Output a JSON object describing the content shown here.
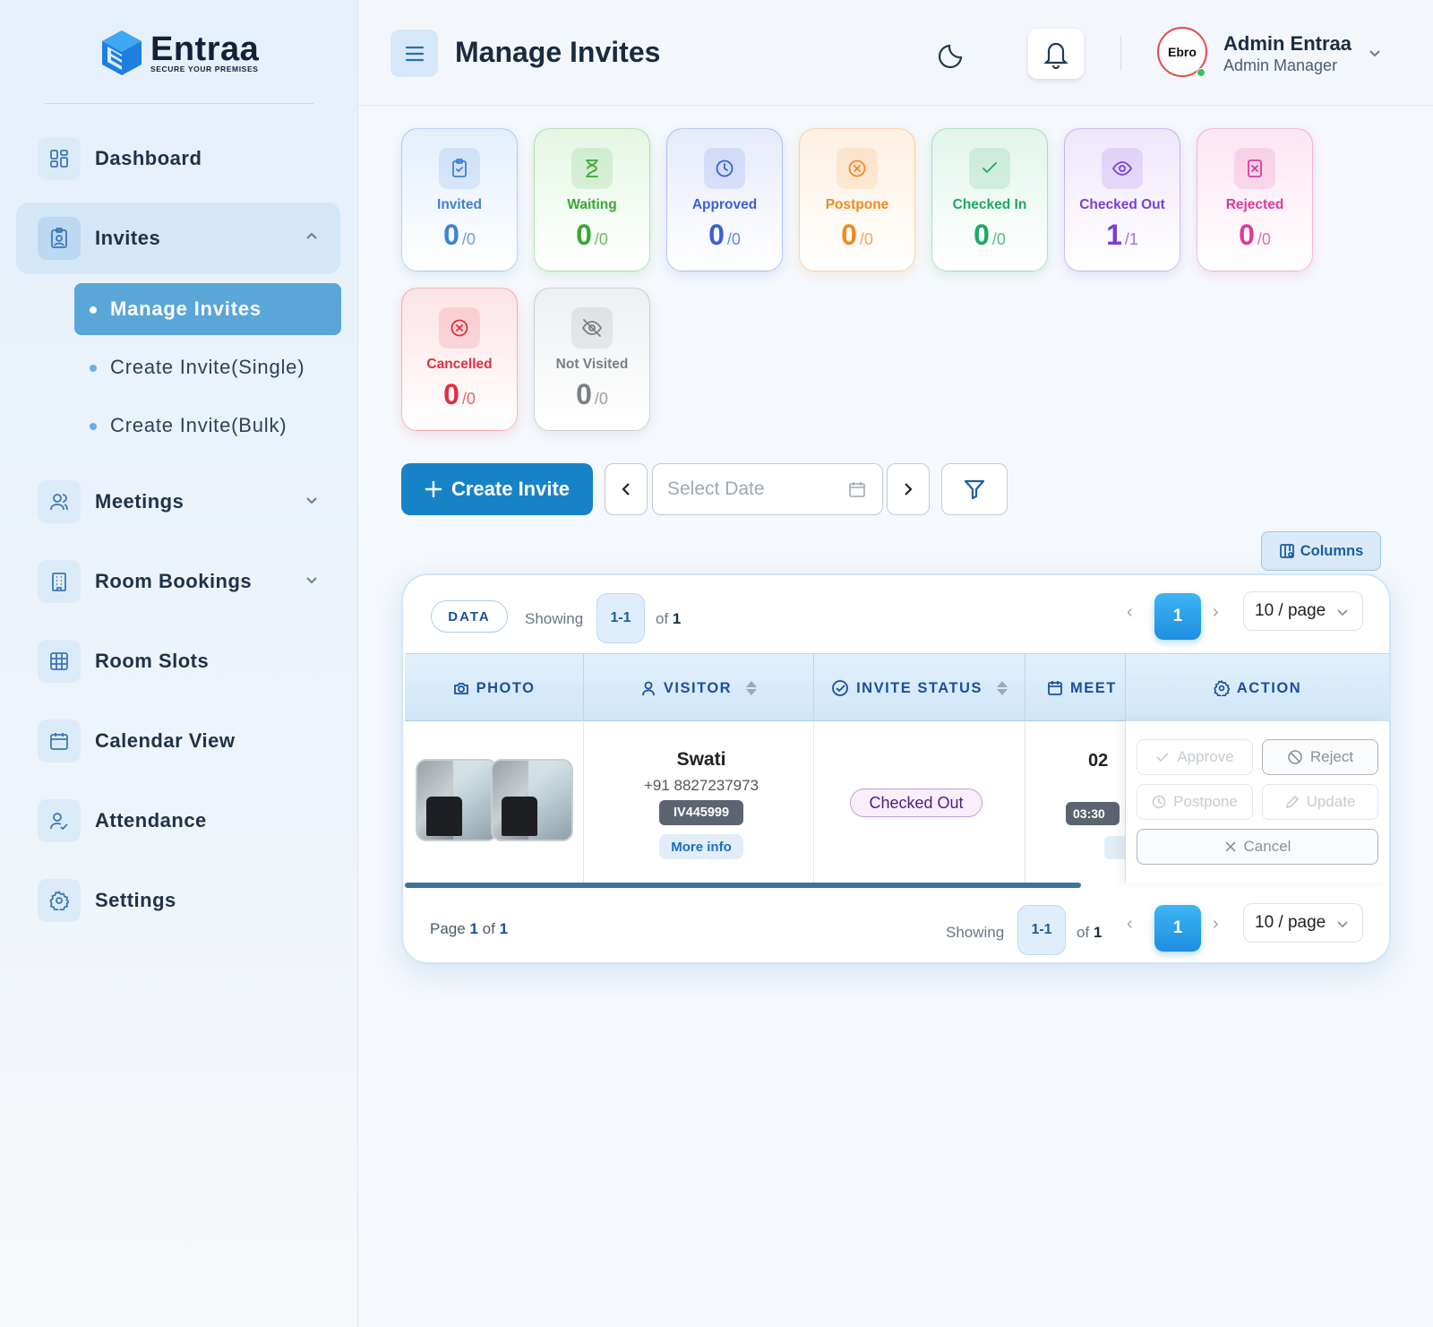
{
  "brand": {
    "name": "Entraa",
    "tagline": "SECURE YOUR PREMISES"
  },
  "sidebar": {
    "items": [
      {
        "label": "Dashboard",
        "icon": "dashboard-icon"
      },
      {
        "label": "Invites",
        "icon": "badge-icon",
        "expanded": true
      },
      {
        "label": "Meetings",
        "icon": "users-icon"
      },
      {
        "label": "Room Bookings",
        "icon": "building-icon"
      },
      {
        "label": "Room Slots",
        "icon": "grid-icon"
      },
      {
        "label": "Calendar View",
        "icon": "calendar-icon"
      },
      {
        "label": "Attendance",
        "icon": "user-check-icon"
      },
      {
        "label": "Settings",
        "icon": "gear-icon"
      }
    ],
    "invites_sub": [
      {
        "label": "Manage Invites",
        "active": true
      },
      {
        "label": "Create Invite(Single)"
      },
      {
        "label": "Create Invite(Bulk)"
      }
    ]
  },
  "header": {
    "title": "Manage Invites",
    "user": {
      "name": "Admin Entraa",
      "role": "Admin Manager",
      "avatar_text": "Ebro"
    }
  },
  "stats": [
    {
      "label": "Invited",
      "value": "0",
      "total": "/0",
      "color": "#3b82d6",
      "icon": "clipboard-check-icon"
    },
    {
      "label": "Waiting",
      "value": "0",
      "total": "/0",
      "color": "#3aa636",
      "icon": "hourglass-icon"
    },
    {
      "label": "Approved",
      "value": "0",
      "total": "/0",
      "color": "#3b5fd6",
      "icon": "clock-icon"
    },
    {
      "label": "Postpone",
      "value": "0",
      "total": "/0",
      "color": "#f08a1e",
      "icon": "circle-x-icon"
    },
    {
      "label": "Checked In",
      "value": "0",
      "total": "/0",
      "color": "#1ea862",
      "icon": "check-icon"
    },
    {
      "label": "Checked Out",
      "value": "1",
      "total": "/1",
      "color": "#7b3fd6",
      "icon": "eye-icon"
    },
    {
      "label": "Rejected",
      "value": "0",
      "total": "/0",
      "color": "#e0389a",
      "icon": "square-x-icon"
    },
    {
      "label": "Cancelled",
      "value": "0",
      "total": "/0",
      "color": "#e0303f",
      "icon": "circle-x-icon"
    },
    {
      "label": "Not Visited",
      "value": "0",
      "total": "/0",
      "color": "#7a7f86",
      "icon": "eye-off-icon"
    }
  ],
  "toolbar": {
    "create_label": "Create Invite",
    "date_placeholder": "Select Date",
    "columns_label": "Columns"
  },
  "table": {
    "data_label": "DATA",
    "showing_label": "Showing",
    "range": "1-1",
    "of_label": "of",
    "total": "1",
    "current_page": "1",
    "page_size": "10 / page",
    "columns": [
      "PHOTO",
      "VISITOR",
      "INVITE STATUS",
      "MEET",
      "ACTION"
    ],
    "rows": [
      {
        "visitor_name": "Swati",
        "phone": "+91 8827237973",
        "code": "IV445999",
        "more_info": "More info",
        "status": "Checked Out",
        "meet_date": "02",
        "meet_time": "03:30",
        "actions": {
          "approve": "Approve",
          "reject": "Reject",
          "postpone": "Postpone",
          "update": "Update",
          "cancel": "Cancel"
        }
      }
    ],
    "footer": {
      "page_word": "Page",
      "page": "1",
      "of_word": "of",
      "pages": "1"
    }
  }
}
